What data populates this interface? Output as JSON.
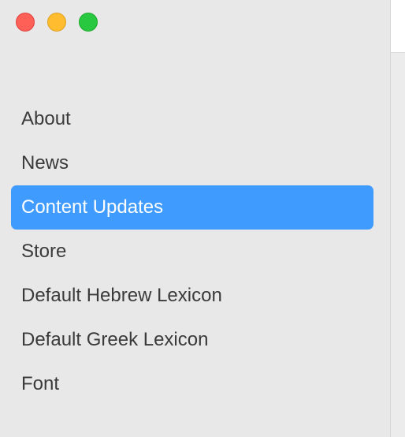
{
  "window": {
    "controls": [
      {
        "name": "close",
        "icon": "close-traffic-light-icon",
        "color": "#fe5f57"
      },
      {
        "name": "minimize",
        "icon": "minimize-traffic-light-icon",
        "color": "#febc2e"
      },
      {
        "name": "zoom",
        "icon": "zoom-traffic-light-icon",
        "color": "#28c840"
      }
    ]
  },
  "sidebar": {
    "selected_index": 2,
    "accent_color": "#3f9bfe",
    "items": [
      {
        "label": "About"
      },
      {
        "label": "News"
      },
      {
        "label": "Content Updates"
      },
      {
        "label": "Store"
      },
      {
        "label": "Default Hebrew Lexicon"
      },
      {
        "label": "Default Greek Lexicon"
      },
      {
        "label": "Font"
      }
    ]
  }
}
